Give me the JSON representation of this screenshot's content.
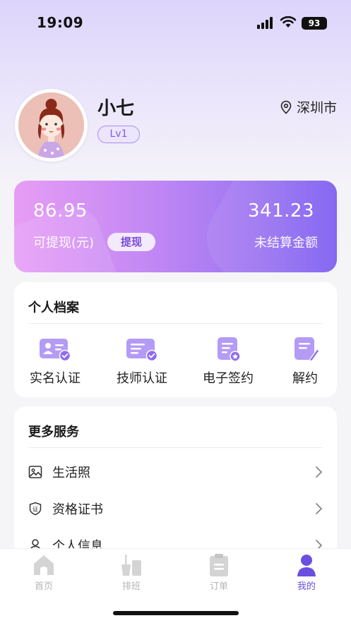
{
  "status": {
    "time": "19:09",
    "battery": "93"
  },
  "profile": {
    "name": "小七",
    "level": "Lv1",
    "location": "深圳市"
  },
  "balance": {
    "withdrawable_amount": "86.95",
    "withdrawable_label": "可提现(元)",
    "withdraw_button": "提现",
    "unsettled_amount": "341.23",
    "unsettled_label": "未结算金额"
  },
  "archive": {
    "title": "个人档案",
    "items": [
      {
        "label": "实名认证",
        "icon": "id-card-icon"
      },
      {
        "label": "技师认证",
        "icon": "certificate-card-icon"
      },
      {
        "label": "电子签约",
        "icon": "e-sign-icon"
      },
      {
        "label": "解约",
        "icon": "terminate-icon"
      }
    ]
  },
  "services": {
    "title": "更多服务",
    "items": [
      {
        "label": "生活照",
        "icon": "photo-icon"
      },
      {
        "label": "资格证书",
        "icon": "certificate-shield-icon"
      },
      {
        "label": "个人信息",
        "icon": "person-icon"
      }
    ]
  },
  "tabs": [
    {
      "label": "首页",
      "icon": "home-icon",
      "active": false
    },
    {
      "label": "排班",
      "icon": "schedule-icon",
      "active": false
    },
    {
      "label": "订单",
      "icon": "order-icon",
      "active": false
    },
    {
      "label": "我的",
      "icon": "profile-icon",
      "active": true
    }
  ],
  "colors": {
    "accent": "#6b4fe0",
    "card_start": "#e79df5",
    "card_end": "#7d5df0",
    "icon_purple": "#9b7cf0"
  }
}
